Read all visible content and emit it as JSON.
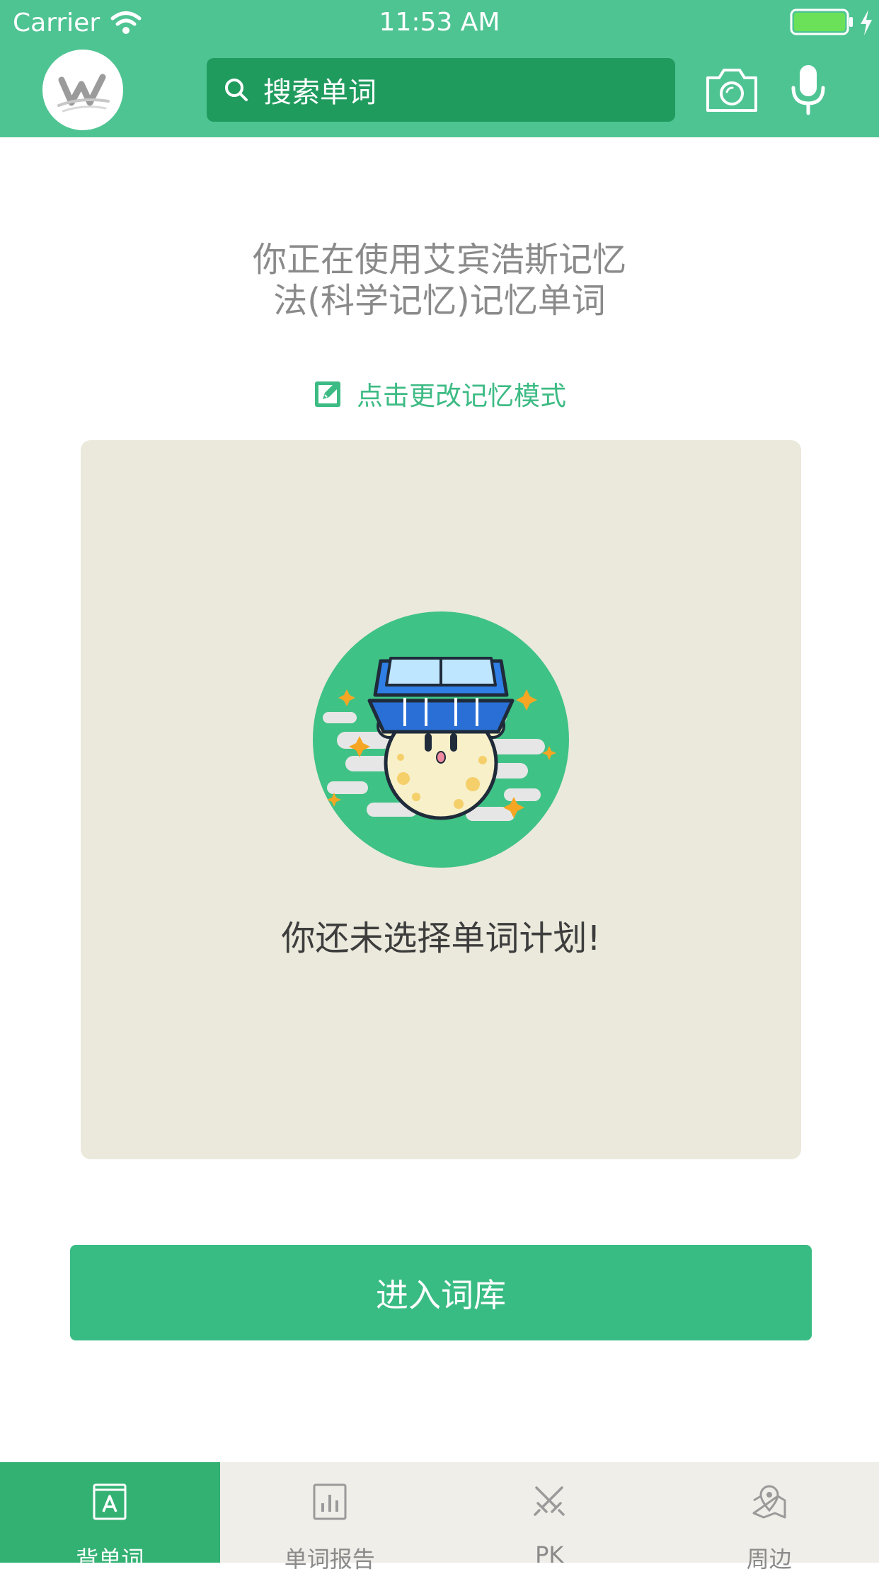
{
  "status_bar": {
    "carrier": "Carrier",
    "time": "11:53 AM"
  },
  "header": {
    "search": {
      "placeholder": "搜索单词"
    },
    "icons": [
      "logo",
      "search-icon",
      "camera-icon",
      "microphone-icon"
    ]
  },
  "main": {
    "intro_line1": "你正在使用艾宾浩斯记忆",
    "intro_line2": "法(科学记忆)记忆单词",
    "change_mode_label": "点击更改记忆模式",
    "empty_message": "你还未选择单词计划!",
    "enter_button_label": "进入词库"
  },
  "tabbar": {
    "tabs": [
      {
        "label": "背单词",
        "icon": "book-icon",
        "active": true
      },
      {
        "label": "单词报告",
        "icon": "bar-chart-icon",
        "active": false
      },
      {
        "label": "PK",
        "icon": "crossed-swords-icon",
        "active": false
      },
      {
        "label": "周边",
        "icon": "map-pin-icon",
        "active": false
      }
    ]
  },
  "colors": {
    "header_green": "#4fc493",
    "search_bg": "#209b5e",
    "accent": "#3dbb84",
    "button": "#39bc84",
    "card_bg": "#ebe9dc",
    "tabbar_bg": "#f0eee8",
    "active_tab": "#33b173"
  }
}
